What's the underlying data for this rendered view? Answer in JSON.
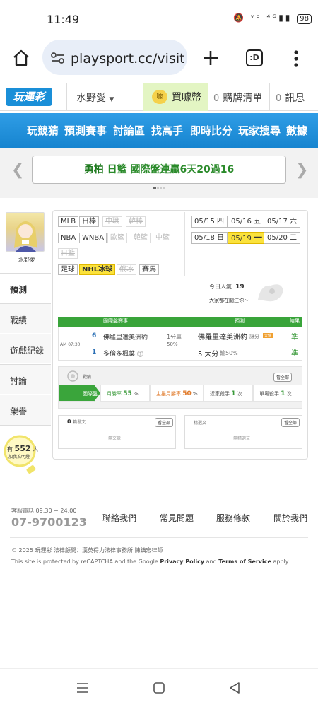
{
  "status": {
    "time": "11:49",
    "battery": "98"
  },
  "browser": {
    "url": "playsport.cc/visit",
    "tab_count": ":D"
  },
  "header": {
    "logo": "玩運彩",
    "user_name": "水野愛",
    "buy_label": "買噱幣",
    "cart_count": "0",
    "cart_label": "購牌清單",
    "msg_count": "0",
    "msg_label": "訊息"
  },
  "nav": [
    "玩競猜",
    "預測賽事",
    "討論區",
    "找高手",
    "即時比分",
    "玩家搜尋",
    "數據"
  ],
  "banner": {
    "prefix": "勇柏",
    "text": "日籃 國際盤連贏6天20過16"
  },
  "profile": {
    "name": "水野愛"
  },
  "sidebar": [
    "預測",
    "戰績",
    "遊戲紀錄",
    "討論",
    "榮譽"
  ],
  "followers": {
    "prefix": "有",
    "count": "552",
    "unit": "人",
    "suffix": "加我為明燈"
  },
  "leagues": {
    "row1": [
      "MLB",
      "日棒",
      "中職",
      "韓棒"
    ],
    "row2": [
      "NBA",
      "WNBA",
      "歐籃",
      "韓籃",
      "中籃"
    ],
    "row3": [
      "日籃"
    ],
    "row4": [
      "足球",
      "NHL冰球",
      "俄冰",
      "賽馬"
    ]
  },
  "dates": [
    {
      "date": "05/15",
      "day": "四"
    },
    {
      "date": "05/16",
      "day": "五"
    },
    {
      "date": "05/17",
      "day": "六"
    },
    {
      "date": "05/18",
      "day": "日"
    },
    {
      "date": "05/19",
      "day": "一"
    },
    {
      "date": "05/20",
      "day": "二"
    }
  ],
  "popularity": {
    "label": "今日人氣",
    "value": "19",
    "follow_text": "大家都在關注你～"
  },
  "table": {
    "headers": [
      "國際盤賽事",
      "預測",
      "結果"
    ],
    "time": "AM 07:30",
    "home_no": "6",
    "home_team": "佛羅里達美洲豹",
    "spread": "1分贏",
    "spread_pct": "50%",
    "away_no": "1",
    "away_team": "多倫多楓葉",
    "away_tag": "主",
    "pick1": "佛羅里達美洲豹",
    "pick1_tag": "讓分",
    "pick1_badge": "大俠",
    "pick2": "5 大分",
    "pick2_pct": "輸50%",
    "result1": "準",
    "result2": "準"
  },
  "record": {
    "title": "戰績",
    "more": "看全部",
    "segments": [
      {
        "label": "國際盤",
        "sub": ""
      },
      {
        "label": "月勝率",
        "value": "55",
        "unit": "%"
      },
      {
        "label": "主推月勝率",
        "value": "50",
        "unit": "%"
      },
      {
        "label": "近家殺手",
        "value": "1",
        "unit": "次"
      },
      {
        "label": "單場殺手",
        "value": "1",
        "unit": "次"
      }
    ]
  },
  "posts": {
    "left": {
      "count": "0",
      "label": "篇發文",
      "more": "看全部",
      "empty": "無文章"
    },
    "right": {
      "label": "精選文",
      "more": "看全部",
      "empty": "無精選文"
    }
  },
  "footer": {
    "hotline_label": "客服電話 09:30 ~ 24:00",
    "hotline": "07-9700123",
    "links": [
      "聯絡我們",
      "常見問題",
      "服務條款",
      "關於我們"
    ],
    "copyright": "© 2025 玩運彩 法律顧問：漢英得力法律事務所 陳鎮宏律師",
    "recaptcha_pre": "This site is protected by reCAPTCHA and the Google",
    "privacy": "Privacy Policy",
    "and": "and",
    "terms": "Terms of Service",
    "apply": "apply."
  }
}
